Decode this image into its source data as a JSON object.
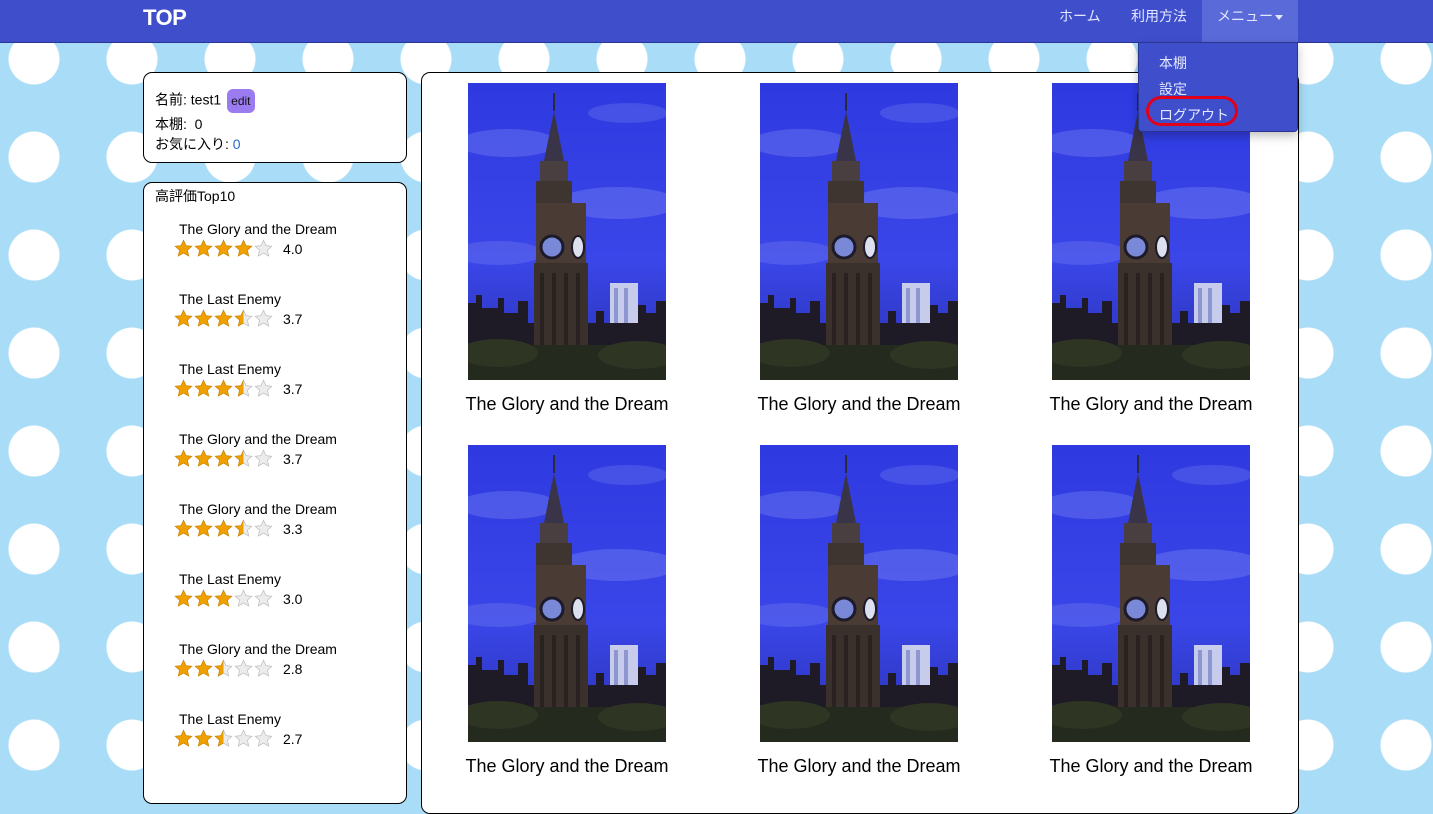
{
  "navbar": {
    "brand": "TOP",
    "home": "ホーム",
    "usage": "利用方法",
    "menu": "メニュー"
  },
  "dropdown": {
    "items": [
      "本棚",
      "設定",
      "ログアウト"
    ]
  },
  "profile": {
    "name_label": "名前: test1",
    "edit_label": "edit",
    "shelf_label": "本棚:",
    "shelf_count": "0",
    "fav_label": "お気に入り:",
    "fav_count": "0"
  },
  "ranking": {
    "title": "高評価Top10",
    "items": [
      {
        "title": "The Glory and the Dream",
        "rating": 4.0,
        "score": "4.0"
      },
      {
        "title": "The Last Enemy",
        "rating": 3.7,
        "score": "3.7"
      },
      {
        "title": "The Last Enemy",
        "rating": 3.7,
        "score": "3.7"
      },
      {
        "title": "The Glory and the Dream",
        "rating": 3.7,
        "score": "3.7"
      },
      {
        "title": "The Glory and the Dream",
        "rating": 3.3,
        "score": "3.3"
      },
      {
        "title": "The Last Enemy",
        "rating": 3.0,
        "score": "3.0"
      },
      {
        "title": "The Glory and the Dream",
        "rating": 2.8,
        "score": "2.8"
      },
      {
        "title": "The Last Enemy",
        "rating": 2.7,
        "score": "2.7"
      }
    ]
  },
  "books": [
    {
      "title": "The Glory and the Dream"
    },
    {
      "title": "The Glory and the Dream"
    },
    {
      "title": "The Glory and the Dream"
    },
    {
      "title": "The Glory and the Dream"
    },
    {
      "title": "The Glory and the Dream"
    },
    {
      "title": "The Glory and the Dream"
    }
  ],
  "colors": {
    "navbar": "#3f4fcc",
    "star": "#f0a000",
    "highlight": "#e0001a",
    "edit_button": "#9b7cf0"
  }
}
